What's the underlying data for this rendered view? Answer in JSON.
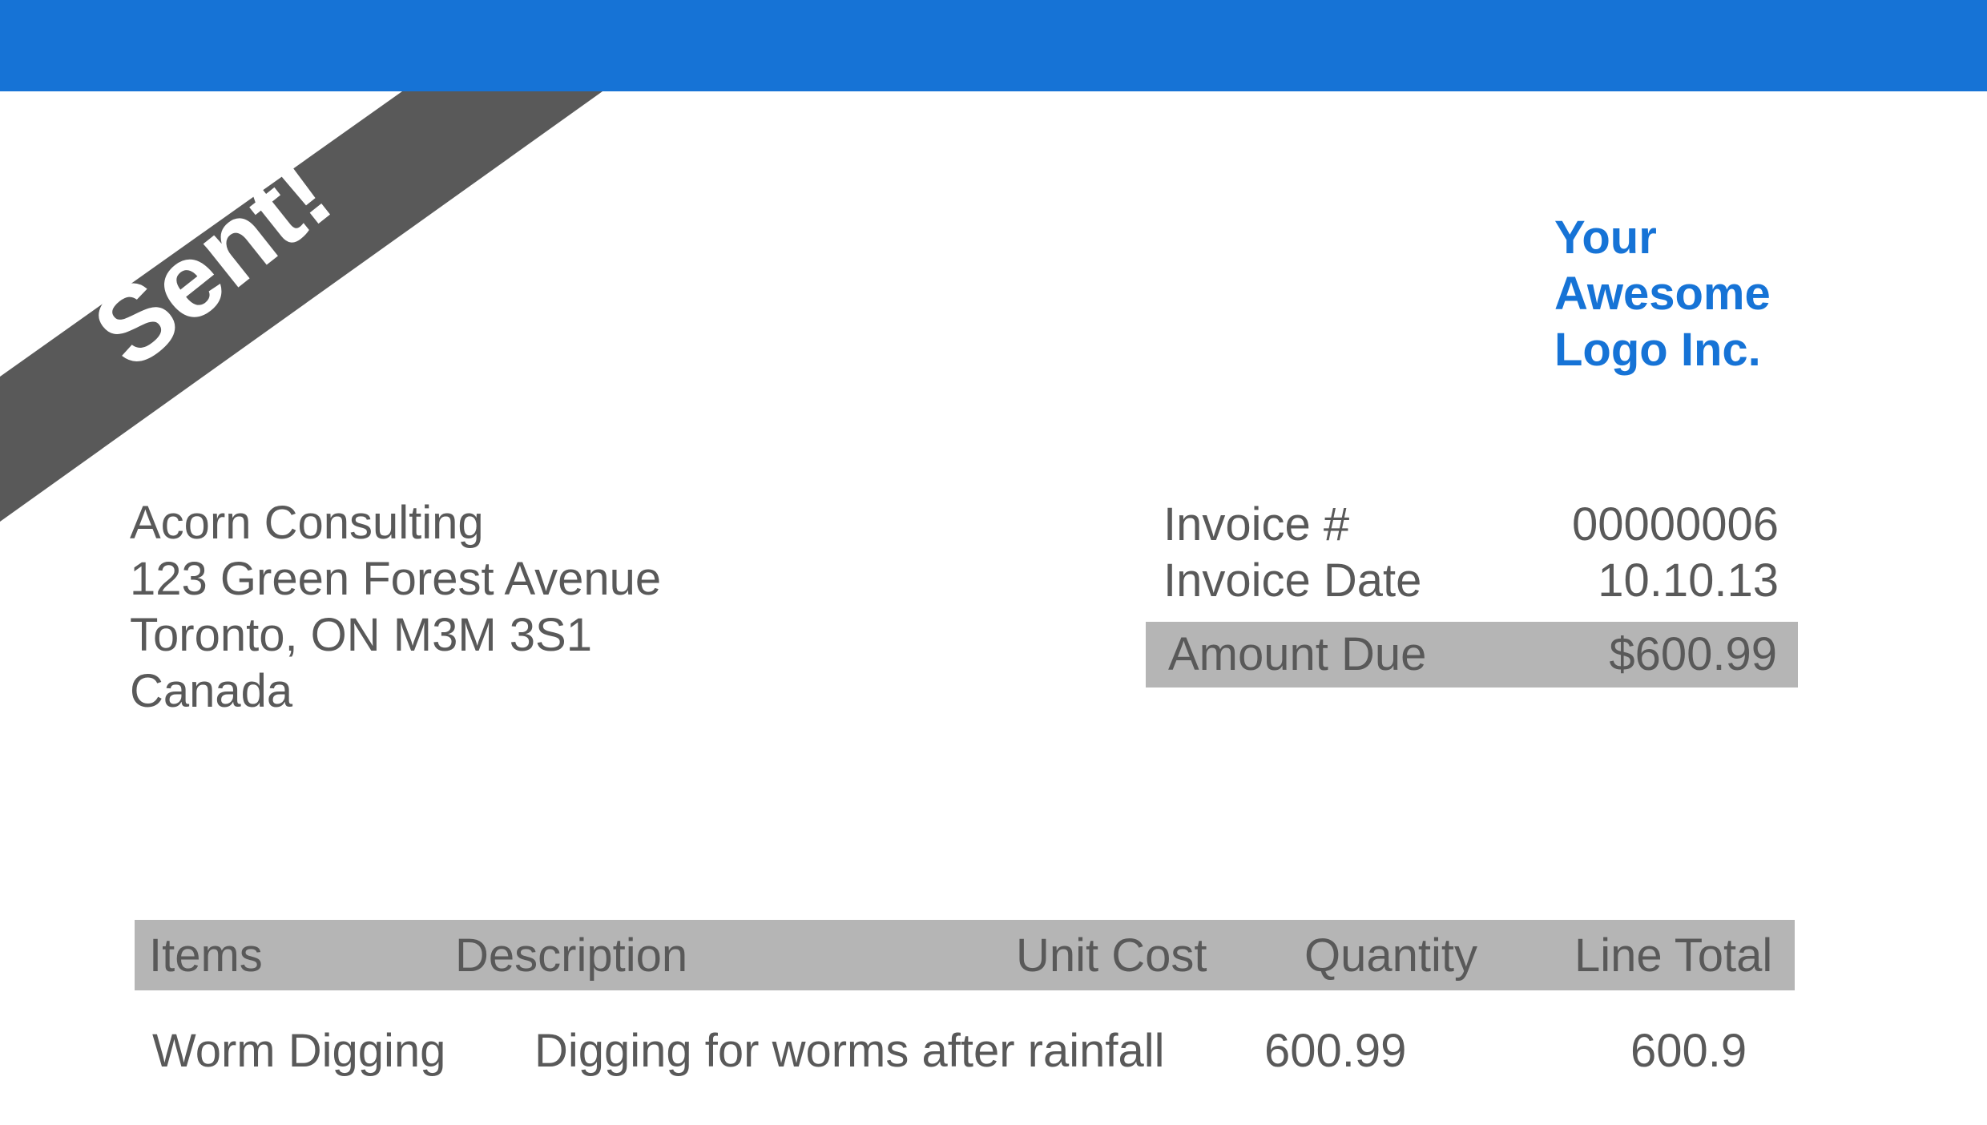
{
  "colors": {
    "brand_blue": "#1673d6",
    "ribbon_gray": "#595959",
    "header_gray": "#b5b5b5",
    "text_gray": "#595959"
  },
  "ribbon": {
    "label": "Sent!"
  },
  "logo": {
    "lines": [
      "Your",
      "Awesome",
      "Logo Inc."
    ]
  },
  "client": {
    "name": "Acorn Consulting",
    "street": "123 Green Forest Avenue",
    "city": "Toronto, ON M3M 3S1",
    "country": "Canada"
  },
  "invoice": {
    "number_label": "Invoice #",
    "number_value": "00000006",
    "date_label": "Invoice Date",
    "date_value": "10.10.13",
    "amount_due_label": "Amount Due",
    "amount_due_value": "$600.99"
  },
  "table": {
    "headers": {
      "items": "Items",
      "description": "Description",
      "unit_cost": "Unit Cost",
      "quantity": "Quantity",
      "line_total": "Line Total"
    },
    "rows": [
      {
        "item": "Worm Digging",
        "description": "Digging for worms after rainfall",
        "unit_cost": "600.99",
        "quantity": "",
        "line_total": "600.9"
      }
    ]
  }
}
